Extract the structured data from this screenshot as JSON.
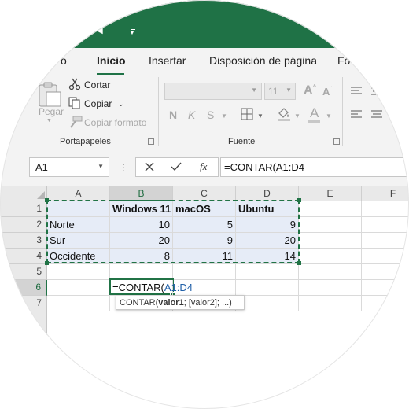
{
  "titlebar": {
    "color": "#1f7246"
  },
  "tabs": [
    {
      "label": "o",
      "active": false
    },
    {
      "label": "Inicio",
      "active": true
    },
    {
      "label": "Insertar",
      "active": false
    },
    {
      "label": "Disposición de página",
      "active": false
    },
    {
      "label": "Fo",
      "active": false
    }
  ],
  "ribbon": {
    "clipboard": {
      "paste_label": "Pegar",
      "cut_label": "Cortar",
      "copy_label": "Copiar",
      "copy_format_label": "Copiar formato",
      "group_label": "Portapapeles"
    },
    "font": {
      "font_name": "",
      "font_size": "11",
      "bold": "N",
      "italic": "K",
      "underline": "S",
      "font_color_letter": "A",
      "group_label": "Fuente"
    }
  },
  "formula_bar": {
    "name_box": "A1",
    "cancel_icon": "x-icon",
    "enter_icon": "check-icon",
    "fx_label": "fx",
    "formula": "=CONTAR(A1:D4"
  },
  "grid": {
    "columns": [
      "A",
      "B",
      "C",
      "D",
      "E",
      "F"
    ],
    "rows": [
      "1",
      "2",
      "3",
      "4",
      "5",
      "6",
      "7"
    ],
    "header_row": [
      "",
      "Windows 11",
      "macOS",
      "Ubuntu"
    ],
    "data_rows": [
      [
        "Norte",
        "10",
        "5",
        "9"
      ],
      [
        "Sur",
        "20",
        "9",
        "20"
      ],
      [
        "Occidente",
        "8",
        "11",
        "14"
      ]
    ],
    "active_cell_prefix": "=CONTAR(",
    "active_cell_ref": "A1:D4",
    "ref_color": "#1f5fa8",
    "accent": "#217346",
    "range_fill": "#e6ecf7"
  },
  "tooltip": {
    "fn": "CONTAR(",
    "arg1": "valor1",
    "rest": "; [valor2]; ...)"
  }
}
